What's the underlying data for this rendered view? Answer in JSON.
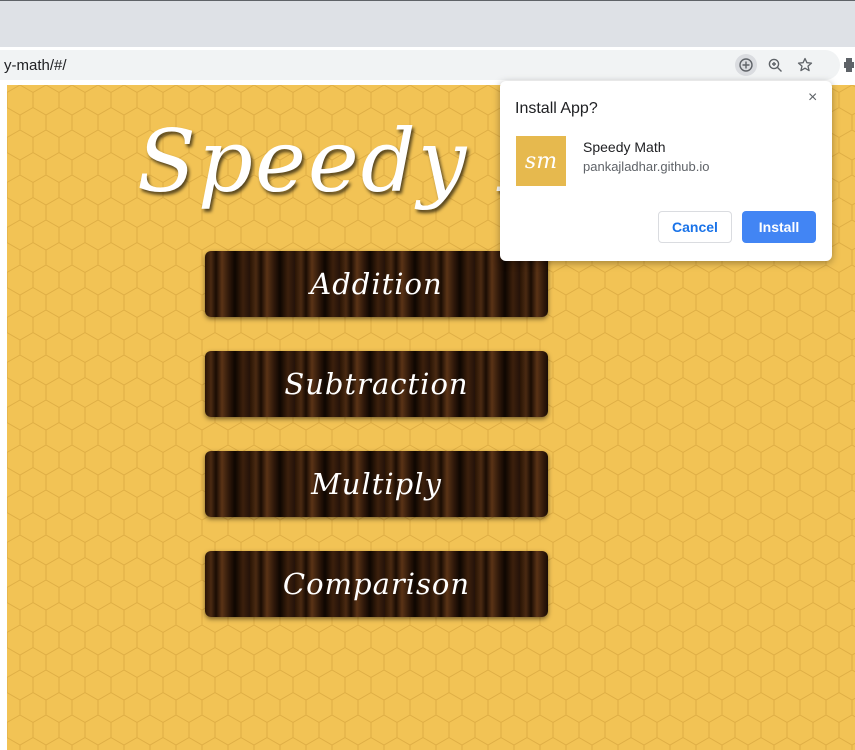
{
  "browser": {
    "url": "y-math/#/",
    "icons": {
      "install": "install-app-icon",
      "zoom": "zoom-icon",
      "bookmark": "star-icon",
      "extension": "extension-icon"
    }
  },
  "page": {
    "title": "Speedy Math",
    "background_color": "#f2c355",
    "menu": [
      {
        "label": "Addition"
      },
      {
        "label": "Subtraction"
      },
      {
        "label": "Multiply"
      },
      {
        "label": "Comparison"
      }
    ]
  },
  "install_dialog": {
    "title": "Install App?",
    "close_symbol": "×",
    "app_logo_text": "sm",
    "app_name": "Speedy Math",
    "app_origin": "pankajladhar.github.io",
    "cancel_label": "Cancel",
    "install_label": "Install",
    "accent_color": "#4285f4"
  }
}
